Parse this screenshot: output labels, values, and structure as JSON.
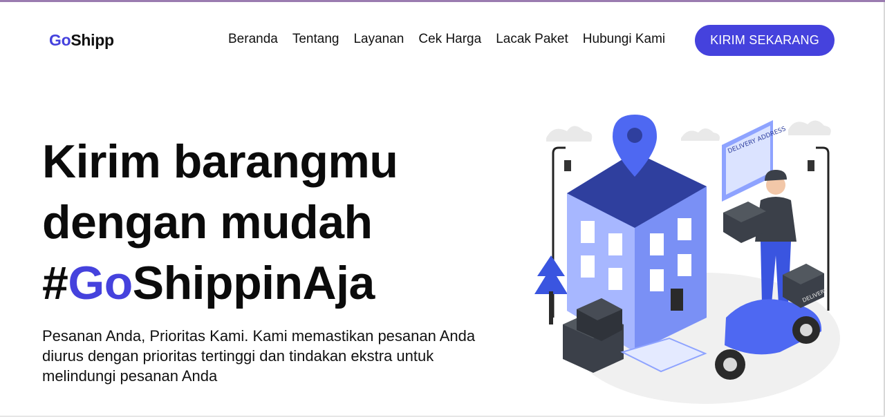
{
  "brand": {
    "prefix": "Go",
    "suffix": "Shipp",
    "accent": "#4542dd"
  },
  "nav": {
    "items": [
      "Beranda",
      "Tentang",
      "Layanan",
      "Cek Harga",
      "Lacak Paket",
      "Hubungi Kami"
    ],
    "cta_label": "KIRIM SEKARANG"
  },
  "hero": {
    "title_line1": "Kirim barangmu",
    "title_line2": "dengan mudah",
    "title_hash": "#",
    "title_highlight": "Go",
    "title_rest": "ShippinAja",
    "subtitle": "Pesanan Anda, Prioritas Kami. Kami memastikan pesanan Anda diurus dengan prioritas tertinggi dan tindakan ekstra untuk melindungi pesanan Anda"
  },
  "illustration": {
    "sign_text": "DELIVERY ADDRESS",
    "box_text": "DELIVERY",
    "icon": "delivery-illustration"
  }
}
